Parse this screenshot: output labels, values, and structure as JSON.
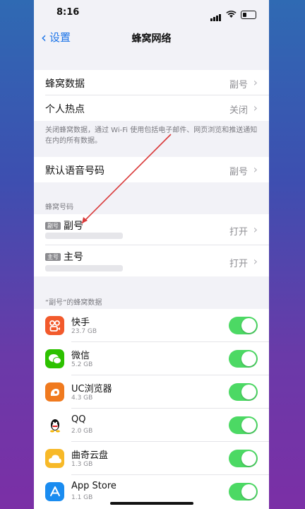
{
  "status": {
    "time": "8:16"
  },
  "nav": {
    "back_label": "设置",
    "title": "蜂窝网络"
  },
  "group1": [
    {
      "label": "蜂窝数据",
      "value": "副号"
    },
    {
      "label": "个人热点",
      "value": "关闭"
    }
  ],
  "note": "关闭蜂窝数据，通过 Wi-Fi 使用包括电子邮件、网页浏览和推送通知在内的所有数据。",
  "voice": {
    "label": "默认语音号码",
    "value": "副号"
  },
  "numbers": {
    "header": "蜂窝号码",
    "items": [
      {
        "badge": "副号",
        "label": "副号",
        "value": "打开"
      },
      {
        "badge": "主号",
        "label": "主号",
        "value": "打开"
      }
    ]
  },
  "apps": {
    "header": "“副号”的蜂窝数据",
    "items": [
      {
        "name": "快手",
        "size": "23.7 GB",
        "icon": "kuaishou-icon",
        "color": "#f25a2c",
        "enabled": true
      },
      {
        "name": "微信",
        "size": "5.2 GB",
        "icon": "wechat-icon",
        "color": "#2dc100",
        "enabled": true
      },
      {
        "name": "UC浏览器",
        "size": "4.3 GB",
        "icon": "uc-browser-icon",
        "color": "#f07a1f",
        "enabled": true
      },
      {
        "name": "QQ",
        "size": "2.0 GB",
        "icon": "qq-icon",
        "color": "#ffffff",
        "enabled": true
      },
      {
        "name": "曲奇云盘",
        "size": "1.3 GB",
        "icon": "cloud-disk-icon",
        "color": "#f7b928",
        "enabled": true
      },
      {
        "name": "App Store",
        "size": "1.1 GB",
        "icon": "app-store-icon",
        "color": "#1a8cf0",
        "enabled": true
      }
    ]
  },
  "colors": {
    "accent": "#1a73e8",
    "toggle_on": "#4cd964",
    "annotation": "#d93a3a"
  }
}
